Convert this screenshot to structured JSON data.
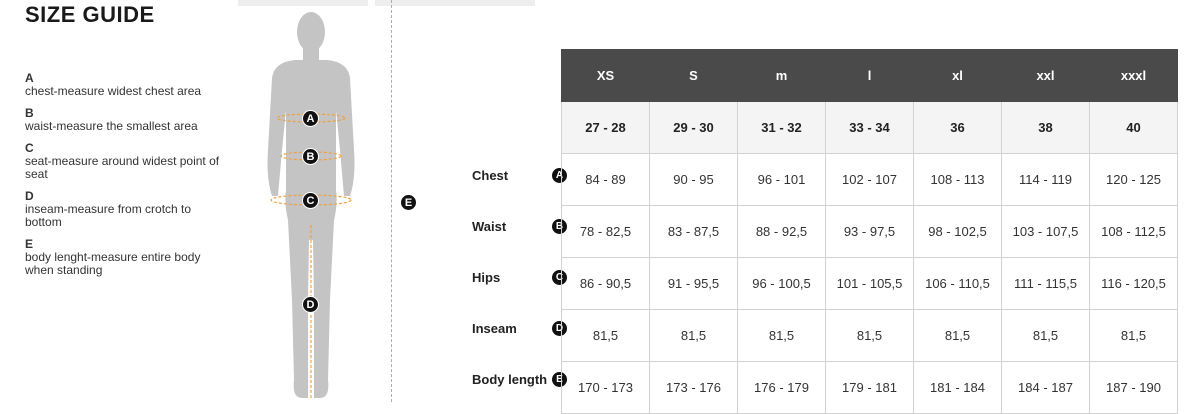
{
  "page": {
    "title": "SIZE GUIDE"
  },
  "legend": [
    {
      "key": "A",
      "text": "chest-measure widest chest area"
    },
    {
      "key": "B",
      "text": "waist-measure the smallest area"
    },
    {
      "key": "C",
      "text": "seat-measure around widest point of seat"
    },
    {
      "key": "D",
      "text": "inseam-measure from crotch to bottom"
    },
    {
      "key": "E",
      "text": "body lenght-measure entire body when standing"
    }
  ],
  "figure_markers": [
    "A",
    "B",
    "C",
    "D",
    "E"
  ],
  "table": {
    "sizes": [
      "XS",
      "S",
      "m",
      "l",
      "xl",
      "xxl",
      "xxxl"
    ],
    "eu_sizes": [
      "27 - 28",
      "29 - 30",
      "31 - 32",
      "33 - 34",
      "36",
      "38",
      "40"
    ],
    "rows": [
      {
        "label": "Chest",
        "marker": "A",
        "values": [
          "84 - 89",
          "90 - 95",
          "96 - 101",
          "102 - 107",
          "108 - 113",
          "114 - 119",
          "120 - 125"
        ]
      },
      {
        "label": "Waist",
        "marker": "B",
        "values": [
          "78 - 82,5",
          "83 - 87,5",
          "88 - 92,5",
          "93 - 97,5",
          "98 - 102,5",
          "103 - 107,5",
          "108 - 112,5"
        ]
      },
      {
        "label": "Hips",
        "marker": "C",
        "values": [
          "86 - 90,5",
          "91 - 95,5",
          "96 - 100,5",
          "101 - 105,5",
          "106 - 110,5",
          "111 - 115,5",
          "116 - 120,5"
        ]
      },
      {
        "label": "Inseam",
        "marker": "D",
        "values": [
          "81,5",
          "81,5",
          "81,5",
          "81,5",
          "81,5",
          "81,5",
          "81,5"
        ]
      },
      {
        "label": "Body length",
        "marker": "E",
        "values": [
          "170 - 173",
          "173 - 176",
          "176 - 179",
          "179 - 181",
          "181 - 184",
          "184 - 187",
          "187 - 190"
        ]
      }
    ]
  },
  "colors": {
    "header_bg": "#4a4a4a",
    "measure_line": "#f0a040",
    "figure": "#c4c4c4"
  }
}
